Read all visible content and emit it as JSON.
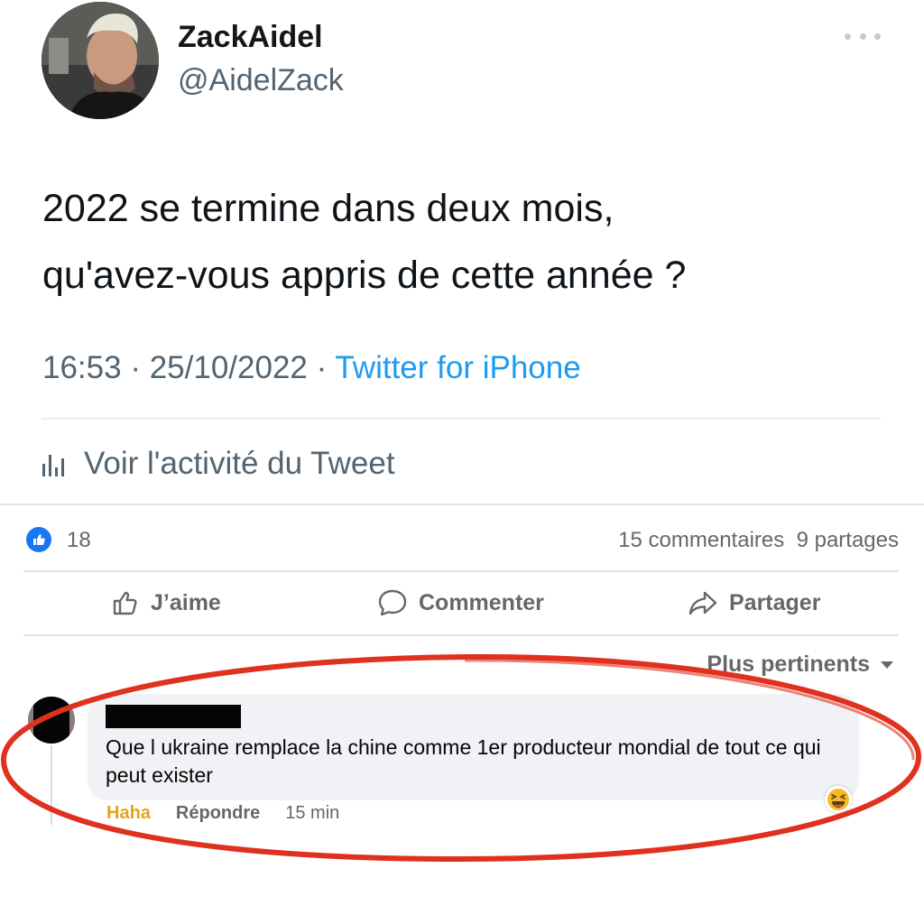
{
  "tweet": {
    "display_name": "ZackAidel",
    "handle": "@AidelZack",
    "text_lines": [
      "2022 se termine dans deux mois,",
      "qu'avez-vous appris de cette année  ?"
    ],
    "time": "16:53",
    "date": "25/10/2022",
    "separator": " · ",
    "source": "Twitter for iPhone",
    "activity_label": "Voir l'activité du Tweet"
  },
  "post_stats": {
    "reaction_count": "18",
    "comments": "15 commentaires",
    "shares": "9 partages"
  },
  "actions": {
    "like": "J’aime",
    "comment": "Commenter",
    "share": "Partager"
  },
  "sort": {
    "label": "Plus pertinents"
  },
  "comment": {
    "text": "Que l ukraine remplace la chine comme 1er producteur mondial de tout ce qui peut exister",
    "reaction_label": "Haha",
    "reply_label": "Répondre",
    "time": "15 min"
  },
  "colors": {
    "twitter_blue": "#1d9bf0",
    "facebook_blue": "#1877f2",
    "haha_yellow": "#e8a21a",
    "highlight_red": "#e0301e"
  }
}
